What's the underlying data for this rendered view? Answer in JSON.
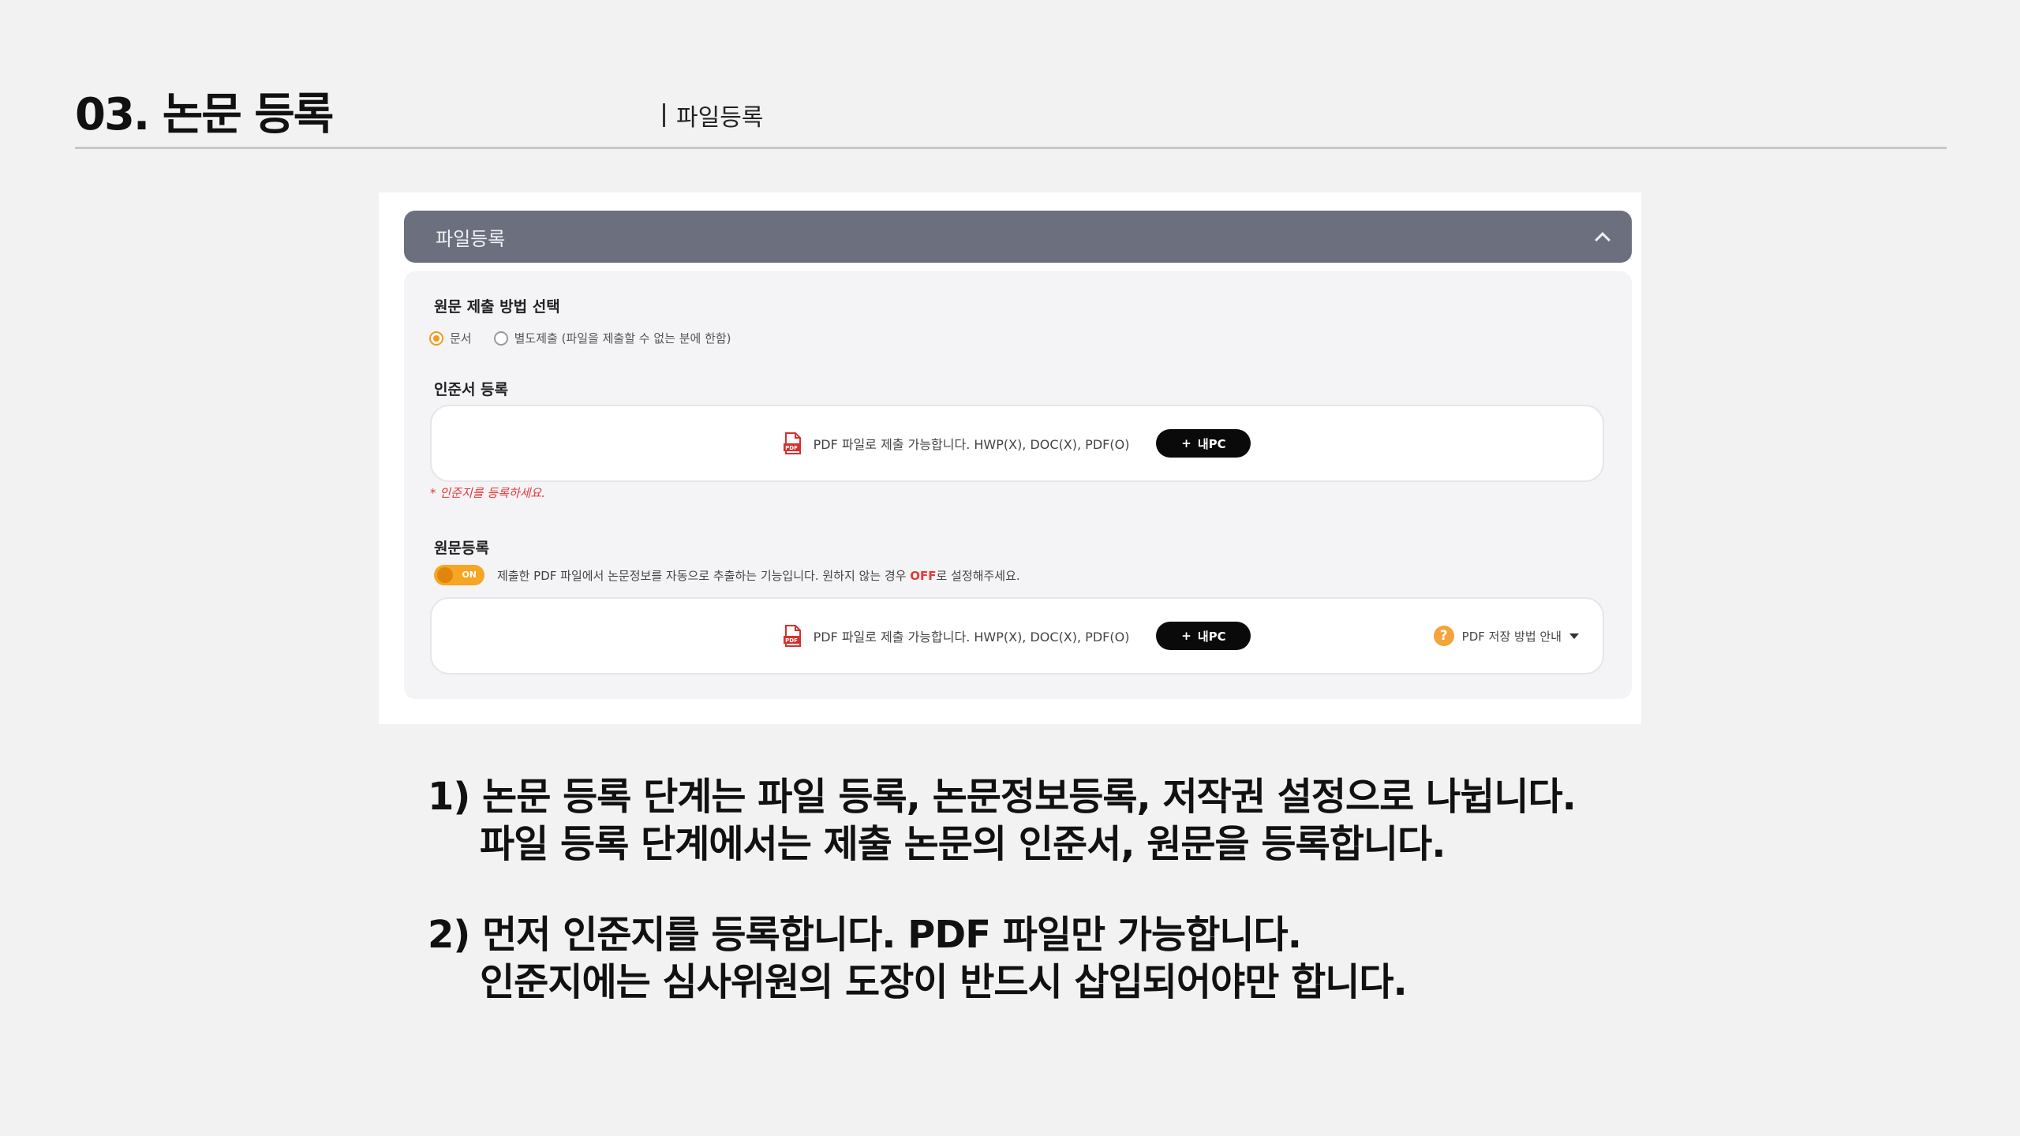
{
  "slide": {
    "title": "03. 논문 등록",
    "section": "파일등록"
  },
  "panel": {
    "header_title": "파일등록",
    "submission_method": {
      "title": "원문 제출 방법 선택",
      "options": [
        "문서",
        "별도제출 (파일을 제출할 수 없는 분에 한함)"
      ],
      "selected": "문서"
    },
    "certificate": {
      "title": "인준서 등록",
      "hint": "PDF 파일로 제출 가능합니다. HWP(X), DOC(X), PDF(O)",
      "button_label": "내PC",
      "warning": "* 인준지를 등록하세요."
    },
    "original": {
      "title": "원문등록",
      "toggle_label": "ON",
      "toggle_state": "on",
      "toggle_desc_before": "제출한 PDF 파일에서 논문정보를 자동으로 추출하는 기능입니다. 원하지 않는 경우 ",
      "toggle_desc_off": "OFF",
      "toggle_desc_after": "로 설정해주세요.",
      "hint": "PDF 파일로 제출 가능합니다. HWP(X), DOC(X), PDF(O)",
      "button_label": "내PC",
      "guide_label": "PDF 저장 방법 안내"
    }
  },
  "notes": [
    {
      "line1": "1) 논문 등록 단계는 파일 등록, 논문정보등록, 저작권 설정으로 나뉩니다.",
      "line2": "파일 등록 단계에서는 제출 논문의 인준서, 원문을 등록합니다."
    },
    {
      "line1": "2) 먼저 인준지를 등록합니다. PDF 파일만 가능합니다.",
      "line2": "인준지에는 심사위원의 도장이 반드시 삽입되어야만 합니다."
    }
  ],
  "colors": {
    "header_bg": "#6b6f7e",
    "accent_orange": "#f6a623",
    "warning_red": "#e23a3a",
    "pdf_red": "#d9302c"
  },
  "icons": [
    "chevron-up-icon",
    "pdf-file-icon",
    "plus-icon",
    "help-icon",
    "caret-down-icon"
  ]
}
